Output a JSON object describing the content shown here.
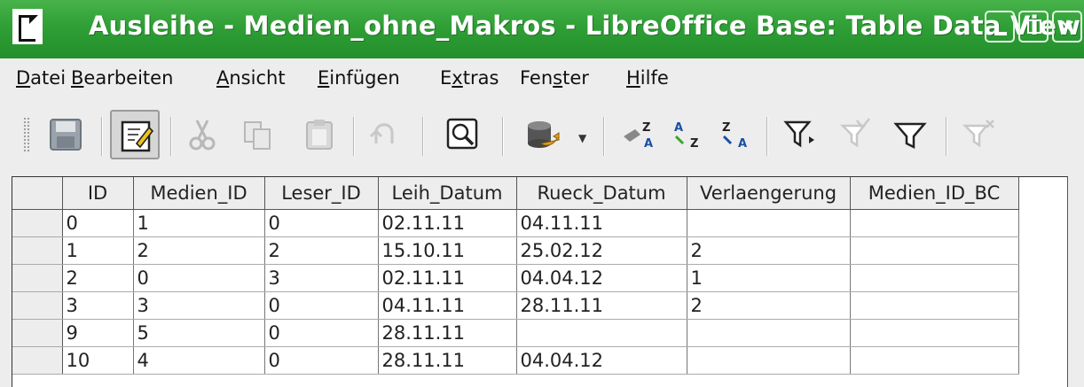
{
  "window": {
    "title": "Ausleihe - Medien_ohne_Makros - LibreOffice Base: Table Data View"
  },
  "menu": [
    {
      "text": "Datei",
      "ul": "D"
    },
    {
      "text": "Bearbeiten",
      "ul": "B"
    },
    {
      "text": "Ansicht",
      "ul": "A"
    },
    {
      "text": "Einfügen",
      "ul": "E"
    },
    {
      "text": "Extras",
      "ul": "x"
    },
    {
      "text": "Fenster",
      "ul": "s"
    },
    {
      "text": "Hilfe",
      "ul": "H"
    }
  ],
  "toolbar": {
    "icons": [
      "save-icon",
      "edit-data-icon",
      "cut-icon",
      "copy-icon",
      "paste-icon",
      "undo-icon",
      "find-icon",
      "data-source-icon",
      "sort-icon",
      "sort-ascending-icon",
      "sort-descending-icon",
      "autofilter-icon",
      "standard-filter-icon",
      "apply-filter-icon",
      "remove-filter-icon"
    ]
  },
  "table": {
    "columns": [
      "ID",
      "Medien_ID",
      "Leser_ID",
      "Leih_Datum",
      "Rueck_Datum",
      "Verlaengerung",
      "Medien_ID_BC"
    ],
    "rows": [
      [
        "0",
        "1",
        "0",
        "02.11.11",
        "04.11.11",
        "",
        ""
      ],
      [
        "1",
        "2",
        "2",
        "15.10.11",
        "25.02.12",
        "2",
        ""
      ],
      [
        "2",
        "0",
        "3",
        "02.11.11",
        "04.04.12",
        "1",
        ""
      ],
      [
        "3",
        "3",
        "0",
        "04.11.11",
        "28.11.11",
        "2",
        ""
      ],
      [
        "9",
        "5",
        "0",
        "28.11.11",
        "",
        "",
        ""
      ],
      [
        "10",
        "4",
        "0",
        "28.11.11",
        "04.04.12",
        "",
        ""
      ]
    ]
  },
  "colors": {
    "titlebar": "#2f9f36",
    "background": "#ededed"
  }
}
